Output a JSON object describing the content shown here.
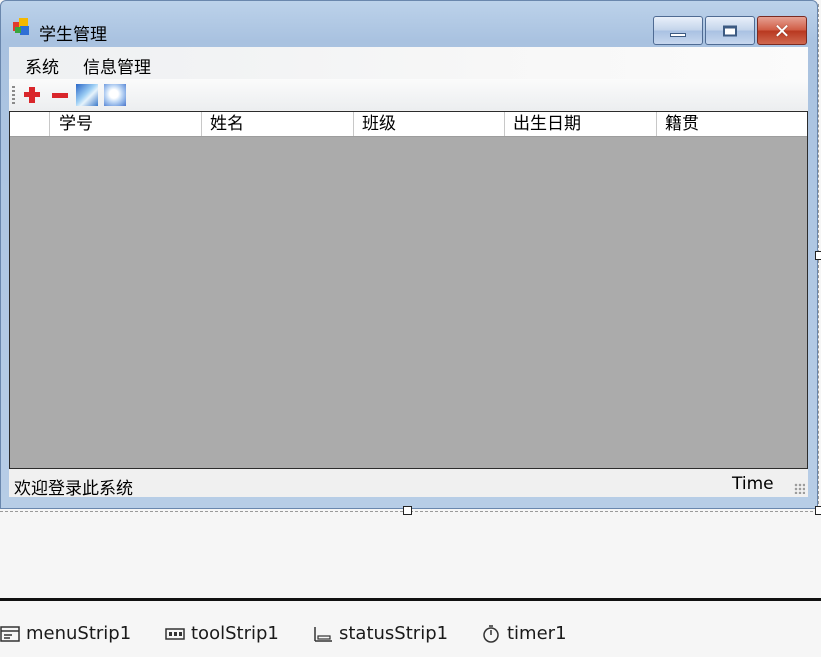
{
  "window": {
    "title": "学生管理",
    "icon": "app-form-icon",
    "buttons": {
      "minimize": "minimize-icon",
      "maximize": "maximize-icon",
      "close": "close-icon",
      "close_glyph": "✕"
    }
  },
  "menu": {
    "items": [
      {
        "label": "系统"
      },
      {
        "label": "信息管理"
      }
    ]
  },
  "toolbar": {
    "buttons": [
      {
        "icon": "add-icon"
      },
      {
        "icon": "remove-icon"
      },
      {
        "icon": "picture-icon"
      },
      {
        "icon": "picture-bubble-icon"
      }
    ]
  },
  "grid": {
    "columns": [
      "学号",
      "姓名",
      "班级",
      "出生日期",
      "籍贯"
    ],
    "rows": [],
    "background_color": "#ababab"
  },
  "status": {
    "welcome": "欢迎登录此系统",
    "time": "Time"
  },
  "tray": {
    "components": [
      {
        "label": "menuStrip1",
        "icon": "menustrip-icon"
      },
      {
        "label": "toolStrip1",
        "icon": "toolstrip-icon"
      },
      {
        "label": "statusStrip1",
        "icon": "statusstrip-icon"
      },
      {
        "label": "timer1",
        "icon": "timer-icon"
      }
    ]
  },
  "colors": {
    "title_gradient": "#a9c2e0",
    "close_button": "#c8452f",
    "toolbar_symbol": "#d9262b"
  }
}
